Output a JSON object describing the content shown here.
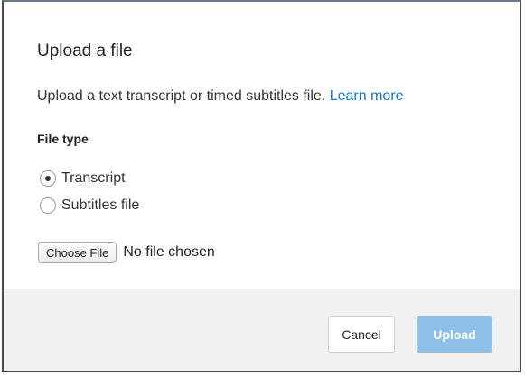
{
  "dialog": {
    "title": "Upload a file",
    "description": "Upload a text transcript or timed subtitles file.",
    "learn_more": "Learn more",
    "file_type_label": "File type",
    "options": [
      {
        "label": "Transcript",
        "checked": true
      },
      {
        "label": "Subtitles file",
        "checked": false
      }
    ],
    "choose_file_label": "Choose File",
    "file_status": "No file chosen",
    "cancel_label": "Cancel",
    "upload_label": "Upload",
    "upload_enabled": false
  },
  "colors": {
    "link": "#1a73c8",
    "upload_disabled_bg": "#8ec0e8",
    "footer_bg": "#f1f1f1"
  }
}
